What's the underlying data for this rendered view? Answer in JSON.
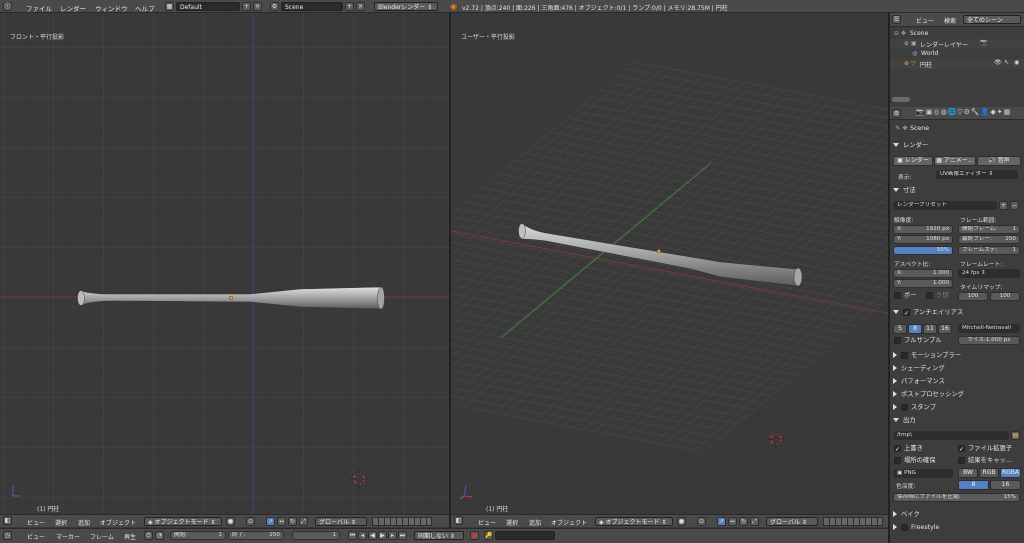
{
  "topbar": {
    "menus": [
      "ファイル",
      "レンダー",
      "ウィンドウ",
      "ヘルプ"
    ],
    "layout": "Default",
    "scene": "Scene",
    "engine": "Blenderレンダー",
    "info": "v2.72 | 頂点:240 | 面:226 | 三角面:476 | オブジェクト:0/1 | ランプ:0/0 | メモリ:28.75M | 円柱"
  },
  "viewport_left": {
    "title": "フロント・平行投影",
    "object_label": "(1) 円柱"
  },
  "viewport_right": {
    "title": "ユーザー・平行投影",
    "object_label": "(1) 円柱"
  },
  "view_header": {
    "items": [
      "ビュー",
      "選択",
      "追加",
      "オブジェクト"
    ],
    "mode": "オブジェクトモード",
    "orientation": "グローバル"
  },
  "timeline": {
    "items": [
      "ビュー",
      "マーカー",
      "フレーム",
      "再生"
    ],
    "start_label": "開始:",
    "start_value": "1",
    "end_label": "終了:",
    "end_value": "250",
    "current": "1",
    "sync": "同期しない"
  },
  "outliner": {
    "view": "ビュー",
    "search": "検索",
    "filter": "全てのシーン",
    "items": [
      "Scene",
      "レンダーレイヤー",
      "World",
      "円柱"
    ]
  },
  "properties": {
    "context": "Scene",
    "render_section": "レンダー",
    "render_buttons": [
      "レンダー",
      "アニメー…",
      "音声"
    ],
    "display_label": "表示:",
    "display_value": "UV画像エディター",
    "dimensions_section": "寸法",
    "preset": "レンダープリセット",
    "resolution_label": "解像度:",
    "res_x": "X:",
    "res_x_val": "1920 px",
    "res_y": "Y:",
    "res_y_val": "1080 px",
    "res_pct": "50%",
    "frame_range_label": "フレーム範囲:",
    "frame_start": "開始フレーム:",
    "frame_start_val": "1",
    "frame_end": "最終フレー:",
    "frame_end_val": "250",
    "frame_step": "フレームステ:",
    "frame_step_val": "1",
    "aspect_label": "アスペクト比:",
    "asp_x": "X:",
    "asp_x_val": "1.000",
    "asp_y": "Y:",
    "asp_y_val": "1.000",
    "fps_label": "フレームレート:",
    "fps": "24 fps",
    "timeremap_label": "タイムリマップ:",
    "remap_old": "100",
    "remap_new": "100",
    "border": "ボー",
    "crop": "ク切",
    "aa_section": "アンチエイリアス",
    "aa_samples": [
      "5",
      "8",
      "11",
      "16"
    ],
    "aa_filter": "Mitchell-Netravali",
    "full_sample": "フルサンプル",
    "aa_size": "サイズ:1.000 px",
    "collapsed": [
      "モーションブラー",
      "シェーディング",
      "パフォーマンス",
      "ポストプロセッシング",
      "スタンプ"
    ],
    "output_section": "出力",
    "output_path": "/tmp\\",
    "overwrite": "上書き",
    "file_ext": "ファイル拡張子",
    "placeholders": "場所の確保",
    "cache": "結果をキャッ…",
    "format": "PNG",
    "color_modes": [
      "BW",
      "RGB",
      "RGBA"
    ],
    "color_depth_label": "色深度:",
    "depth_8": "8",
    "depth_16": "16",
    "compression": "保存時にファイルを圧縮:",
    "compression_val": "15%",
    "bake_section": "ベイク",
    "freestyle_section": "Freestyle"
  }
}
